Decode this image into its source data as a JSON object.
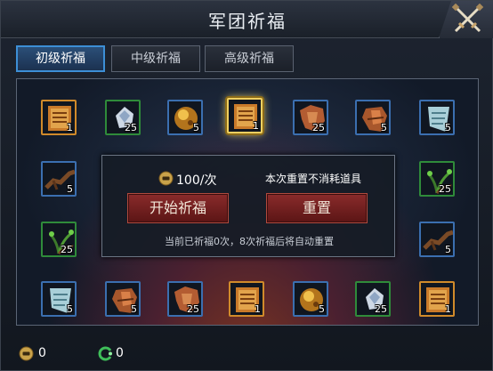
{
  "window": {
    "title": "军团祈福",
    "close_icon": "crossed-swords-close-icon"
  },
  "tabs": [
    {
      "label": "初级祈福",
      "active": true
    },
    {
      "label": "中级祈福",
      "active": false
    },
    {
      "label": "高级祈福",
      "active": false
    }
  ],
  "board": {
    "items": [
      {
        "icon": "scroll-item-icon",
        "frame": "gold",
        "qty": "1"
      },
      {
        "icon": "crystal-ore-icon",
        "frame": "green",
        "qty": "25"
      },
      {
        "icon": "gold-orb-icon",
        "frame": "blue",
        "qty": "5"
      },
      {
        "icon": "scroll-item-icon",
        "frame": "gold",
        "qty": "1",
        "selected": true
      },
      {
        "icon": "hide-pelt-icon",
        "frame": "blue",
        "qty": "25"
      },
      {
        "icon": "leather-armor-icon",
        "frame": "blue",
        "qty": "5"
      },
      {
        "icon": "silver-scroll-icon",
        "frame": "blue",
        "qty": "5"
      },
      {
        "icon": "wooden-branch-icon",
        "frame": "blue",
        "qty": "5"
      },
      {
        "icon": "herb-icon",
        "frame": "green",
        "qty": "25"
      },
      {
        "icon": "herb-icon",
        "frame": "green",
        "qty": "25"
      },
      {
        "icon": "wooden-branch-icon",
        "frame": "blue",
        "qty": "5"
      },
      {
        "icon": "silver-scroll-icon",
        "frame": "blue",
        "qty": "5"
      },
      {
        "icon": "leather-armor-icon",
        "frame": "blue",
        "qty": "5"
      },
      {
        "icon": "hide-pelt-icon",
        "frame": "blue",
        "qty": "25"
      },
      {
        "icon": "scroll-item-icon",
        "frame": "gold",
        "qty": "1"
      },
      {
        "icon": "gold-orb-icon",
        "frame": "blue",
        "qty": "5"
      },
      {
        "icon": "crystal-ore-icon",
        "frame": "green",
        "qty": "25"
      },
      {
        "icon": "scroll-item-icon",
        "frame": "gold",
        "qty": "1"
      }
    ]
  },
  "panel": {
    "cost_icon": "coin-icon",
    "cost": "100/次",
    "reset_note": "本次重置不消耗道具",
    "start_label": "开始祈福",
    "reset_label": "重置",
    "status": "当前已祈福0次，8次祈福后将自动重置"
  },
  "footer": {
    "coin_icon": "coin-icon",
    "coin_value": "0",
    "gem_icon": "green-gem-icon",
    "gem_value": "0"
  },
  "colors": {
    "accent_blue": "#3d8fd6",
    "button_red": "#8a2b2b",
    "frame_gold": "#d08a2a",
    "frame_green": "#2f8b3a",
    "frame_blue": "#3b6fb0"
  }
}
